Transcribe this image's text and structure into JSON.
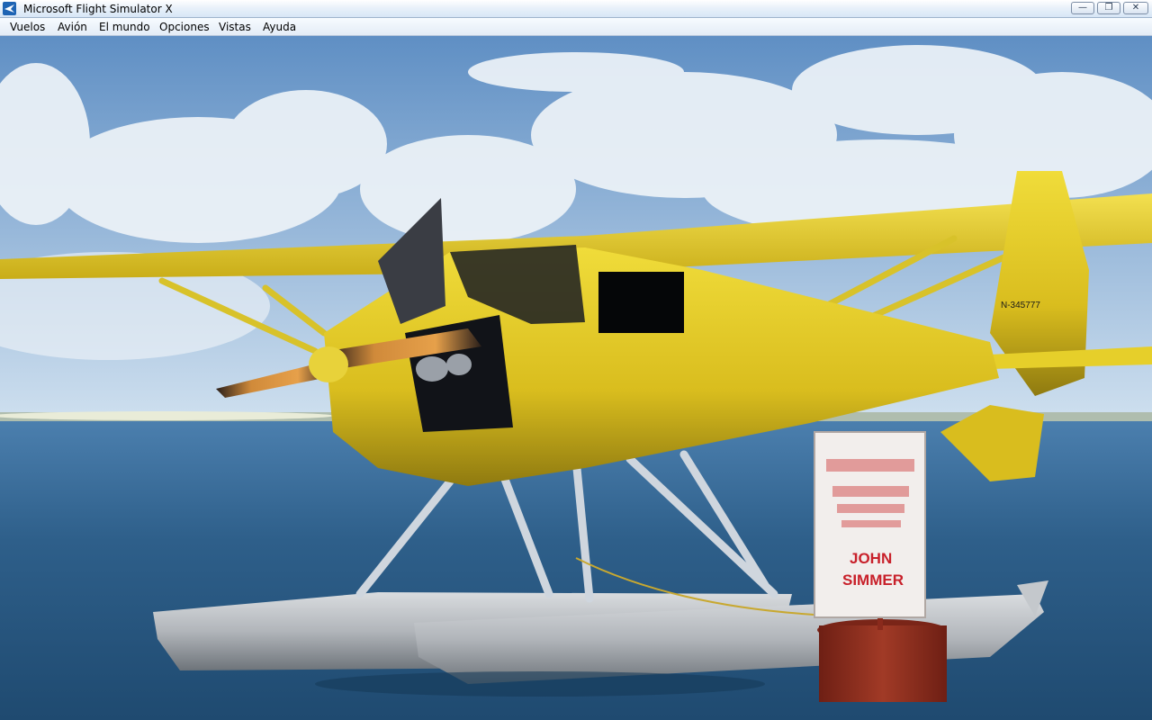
{
  "window": {
    "title": "Microsoft Flight Simulator X",
    "buttons": {
      "minimize": "—",
      "maximize": "❐",
      "close": "✕"
    }
  },
  "menu": {
    "items": [
      {
        "id": "vuelos",
        "label": "Vuelos"
      },
      {
        "id": "avion",
        "label": "Avión"
      },
      {
        "id": "el-mundo",
        "label": "El mundo"
      },
      {
        "id": "opciones",
        "label": "Opciones"
      },
      {
        "id": "vistas",
        "label": "Vistas"
      },
      {
        "id": "ayuda",
        "label": "Ayuda"
      }
    ]
  },
  "scene": {
    "aircraft_registration": "N-345777",
    "sign": {
      "line1": "JOHN",
      "line2": "SIMMER"
    },
    "colors": {
      "sky_top": "#5f8fc4",
      "sky_bottom": "#cfe0ef",
      "sea": "#2e5f8a",
      "fuselage": "#e6cf2a",
      "floats": "#b9bcc0",
      "buoy": "#8a2a1c"
    }
  }
}
